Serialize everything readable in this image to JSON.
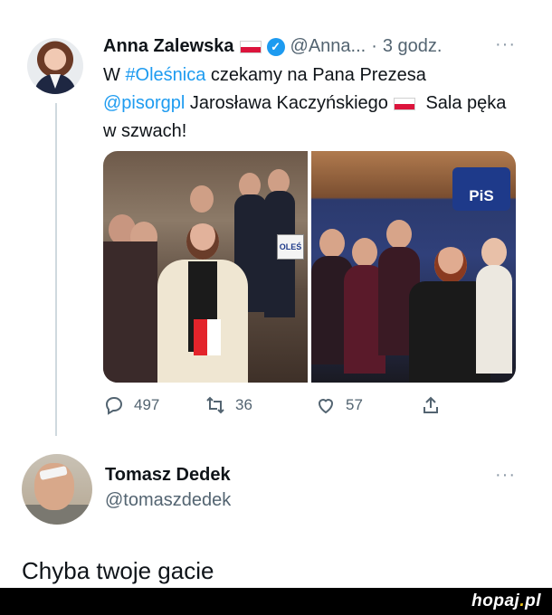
{
  "tweet": {
    "author_name": "Anna Zalewska",
    "handle": "@Anna...",
    "separator": "·",
    "time": "3 godz.",
    "more_icon": "···",
    "text_prefix": "W ",
    "hashtag": "#Oleśnica",
    "text_after_hashtag": " czekamy na Pana Prezesa",
    "mention": "@pisorgpl",
    "text_after_mention": " Jarosława Kaczyńskiego",
    "text_end": " Sala pęka w szwach!",
    "media": {
      "left_caption_sign": "OLEŚ",
      "right_banner": "PiS"
    },
    "stats": {
      "replies": "497",
      "retweets": "36",
      "likes": "57"
    }
  },
  "reply": {
    "author_name": "Tomasz Dedek",
    "handle": "@tomaszdedek",
    "more_icon": "···",
    "text": "Chyba twoje gacie"
  },
  "footer": {
    "watermark_main": "hopaj",
    "watermark_dot": ".",
    "watermark_tld": "pl"
  },
  "colors": {
    "link": "#1d9bf0",
    "text": "#0f1419",
    "muted": "#536471",
    "footer_bg": "#000000"
  },
  "icons": [
    "flag-poland-icon",
    "verified-badge-icon",
    "more-icon",
    "reply-icon",
    "retweet-icon",
    "like-icon",
    "share-icon"
  ]
}
